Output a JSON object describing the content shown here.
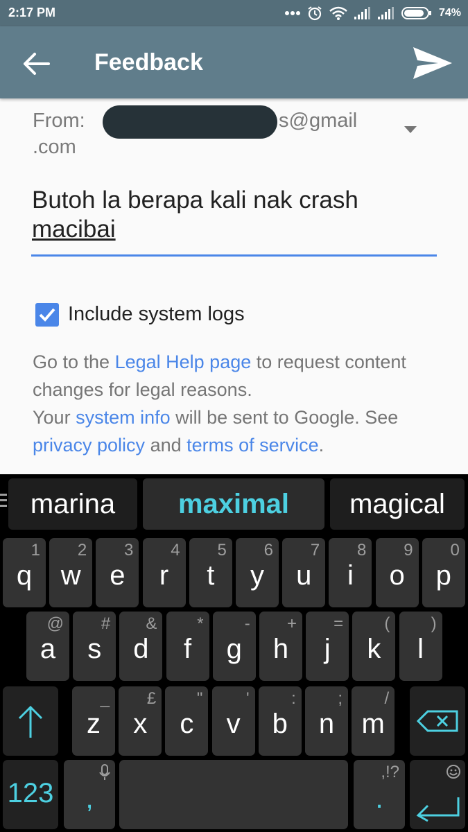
{
  "status_bar": {
    "time": "2:17 PM",
    "battery": "74%",
    "icons": [
      "more-icon",
      "alarm-icon",
      "wifi-icon",
      "signal-icon",
      "signal-icon",
      "battery-icon"
    ]
  },
  "app_bar": {
    "title": "Feedback",
    "back_icon": "arrow-left-icon",
    "send_icon": "send-icon"
  },
  "form": {
    "from_label": "From:",
    "from_domain": "s@gmail",
    "from_value_line2": ".com",
    "message_text": "Butoh la berapa kali nak crash",
    "message_word": "macibai",
    "include_logs_label": "Include system logs",
    "include_logs_checked": true
  },
  "legal": {
    "p1": "Go to the ",
    "link_legal": "Legal Help page",
    "p2": " to request content changes for legal reasons.",
    "p3": "Your ",
    "link_sysinfo": "system info",
    "p4": " will be sent to Google. See ",
    "link_privacy": "privacy policy",
    "p5": " and ",
    "link_terms": "terms of service",
    "p6": "."
  },
  "keyboard": {
    "suggestions": [
      "marina",
      "maximal",
      "magical"
    ],
    "row1": [
      [
        "q",
        "1"
      ],
      [
        "w",
        "2"
      ],
      [
        "e",
        "3"
      ],
      [
        "r",
        "4"
      ],
      [
        "t",
        "5"
      ],
      [
        "y",
        "6"
      ],
      [
        "u",
        "7"
      ],
      [
        "i",
        "8"
      ],
      [
        "o",
        "9"
      ],
      [
        "p",
        "0"
      ]
    ],
    "row2": [
      [
        "a",
        "@"
      ],
      [
        "s",
        "#"
      ],
      [
        "d",
        "&"
      ],
      [
        "f",
        "*"
      ],
      [
        "g",
        "-"
      ],
      [
        "h",
        "+"
      ],
      [
        "j",
        "="
      ],
      [
        "k",
        "("
      ],
      [
        "l",
        ")"
      ]
    ],
    "row3": [
      [
        "z",
        "_"
      ],
      [
        "x",
        "£"
      ],
      [
        "c",
        "\""
      ],
      [
        "v",
        "'"
      ],
      [
        "b",
        ":"
      ],
      [
        "n",
        ";"
      ],
      [
        "m",
        "/"
      ]
    ],
    "numbers_key": "123",
    "comma_key": ",",
    "period_key": ".",
    "period_hint": ",!?",
    "accent_color": "#4dd0e1"
  }
}
